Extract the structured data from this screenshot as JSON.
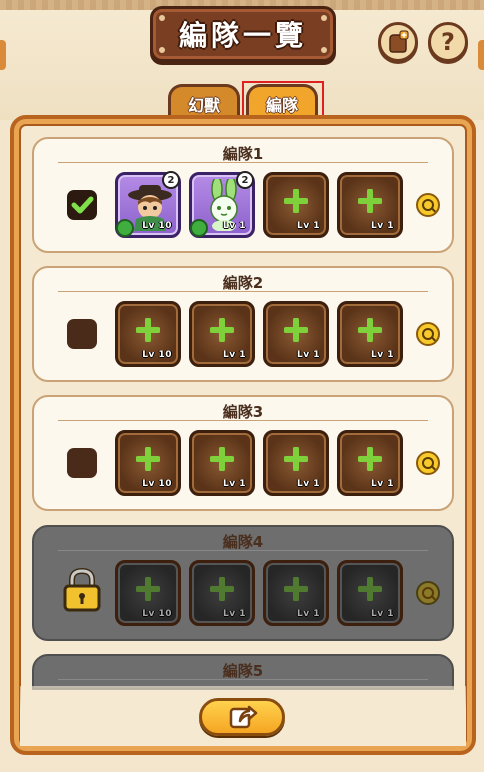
{
  "header": {
    "title": "編隊一覽",
    "shop_icon": "bag-plus-icon",
    "help_label": "?"
  },
  "tabs": [
    {
      "label": "幻獸",
      "active": false
    },
    {
      "label": "編隊",
      "active": true
    }
  ],
  "teams": [
    {
      "title": "編隊1",
      "selected": true,
      "locked": false,
      "slots": [
        {
          "type": "character",
          "level": "Lv 10",
          "badge": "2",
          "element": "leaf-icon",
          "name": "cowboy-hat-character"
        },
        {
          "type": "character",
          "level": "Lv 1",
          "badge": "2",
          "element": "leaf-icon",
          "name": "green-rabbit-character"
        },
        {
          "type": "empty",
          "level": "Lv 1"
        },
        {
          "type": "empty",
          "level": "Lv 1"
        }
      ]
    },
    {
      "title": "編隊2",
      "selected": false,
      "locked": false,
      "slots": [
        {
          "type": "empty",
          "level": "Lv 10"
        },
        {
          "type": "empty",
          "level": "Lv 1"
        },
        {
          "type": "empty",
          "level": "Lv 1"
        },
        {
          "type": "empty",
          "level": "Lv 1"
        }
      ]
    },
    {
      "title": "編隊3",
      "selected": false,
      "locked": false,
      "slots": [
        {
          "type": "empty",
          "level": "Lv 10"
        },
        {
          "type": "empty",
          "level": "Lv 1"
        },
        {
          "type": "empty",
          "level": "Lv 1"
        },
        {
          "type": "empty",
          "level": "Lv 1"
        }
      ]
    },
    {
      "title": "編隊4",
      "selected": false,
      "locked": true,
      "slots": [
        {
          "type": "empty",
          "level": "Lv 10"
        },
        {
          "type": "empty",
          "level": "Lv 1"
        },
        {
          "type": "empty",
          "level": "Lv 1"
        },
        {
          "type": "empty",
          "level": "Lv 1"
        }
      ]
    },
    {
      "title": "編隊5",
      "selected": false,
      "locked": true,
      "slots": []
    }
  ],
  "action_button": {
    "icon": "share-arrow-icon"
  },
  "colors": {
    "accent": "#f2a52b",
    "frame": "#b8641f",
    "plus": "#7fd13b",
    "highlight": "#e02020"
  }
}
